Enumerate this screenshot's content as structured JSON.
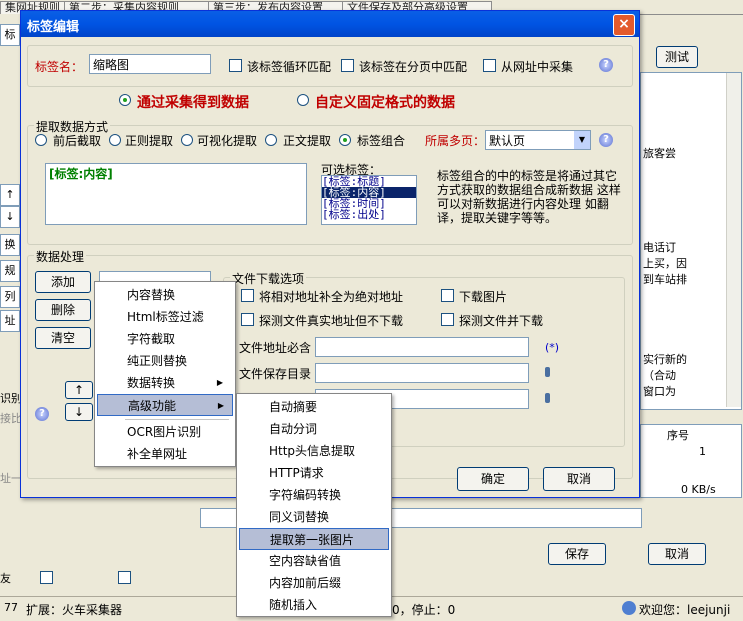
{
  "background": {
    "tabs": [
      "集网址规则",
      "第二步：采集内容规则",
      "第三步：发布内容设置",
      "文件保存及部分高级设置"
    ],
    "left_strip": [
      "标",
      "↑",
      "↓",
      "换到",
      "规则",
      "列出",
      "址"
    ],
    "left_lower": [
      "识别",
      "接比",
      "址一"
    ],
    "right_texts": [
      "旅客尝",
      "电话订",
      "上买，因",
      "到车站排",
      "实行新的",
      "（合动",
      "窗口为"
    ],
    "test_button": "测试",
    "seq_header": "序号",
    "seq_value": "1",
    "speed": "0 KB/s",
    "save_button": "保存",
    "cancel_button": "取消",
    "friend_label": "友"
  },
  "statusbar": {
    "left_num": "77",
    "ext_text": "扩展：火车采集器",
    "stop_text": "0，停止：0",
    "welcome": "欢迎您：leejunji"
  },
  "dialog": {
    "title": "标签编辑",
    "close_symbol": "×",
    "tag_name_label": "标签名：",
    "tag_name_value": "缩略图",
    "loop_match": "该标签循环匹配",
    "page_match": "该标签在分页中匹配",
    "from_url": "从网址中采集",
    "radio_collect": "通过采集得到数据",
    "radio_custom": "自定义固定格式的数据",
    "extract_group": "提取数据方式",
    "extract_options": [
      "前后截取",
      "正则提取",
      "可视化提取",
      "正文提取",
      "标签组合"
    ],
    "multi_page_label": "所属多页：",
    "multi_page_value": "默认页",
    "combo_text": "[标签:内容]",
    "optional_label": "可选标签：",
    "optional_items": [
      "[标签:标题]",
      "[标签:内容]",
      "[标签:时间]",
      "[标签:出处]"
    ],
    "help_text": "标签组合的中的标签是将通过其它方式获取的数据组合成新数据 这样可以对新数据进行内容处理 如翻译，提取关键字等等。",
    "process_group": "数据处理",
    "add_button": "添加",
    "delete_button": "删除",
    "clear_button": "清空",
    "up_arrow": "↑",
    "down_arrow": "↓",
    "file_group": "文件下载选项",
    "file_opts": [
      "将相对地址补全为绝对地址",
      "下载图片",
      "探测文件真实地址但不下载",
      "探测文件并下载"
    ],
    "must_contain_label": "文件地址必含",
    "save_dir_label": "文件保存目录",
    "wildcard": "(*)",
    "ok_button": "确定",
    "cancel_button": "取消"
  },
  "menu_main": {
    "items": [
      {
        "label": "内容替换",
        "submenu": false
      },
      {
        "label": "Html标签过滤",
        "submenu": false
      },
      {
        "label": "字符截取",
        "submenu": false
      },
      {
        "label": "纯正则替换",
        "submenu": false
      },
      {
        "label": "数据转换",
        "submenu": true
      },
      {
        "label": "高级功能",
        "submenu": true
      },
      {
        "label": "OCR图片识别",
        "submenu": false
      },
      {
        "label": "补全单网址",
        "submenu": false
      }
    ]
  },
  "menu_sub": {
    "items": [
      "自动摘要",
      "自动分词",
      "Http头信息提取",
      "HTTP请求",
      "字符编码转换",
      "同义词替换",
      "提取第一张图片",
      "空内容缺省值",
      "内容加前后缀",
      "随机插入"
    ]
  }
}
